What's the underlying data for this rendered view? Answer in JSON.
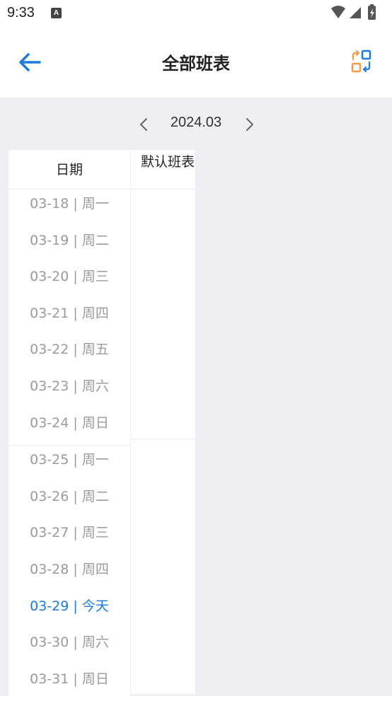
{
  "status": {
    "time": "9:33",
    "app_icon": "A"
  },
  "header": {
    "title": "全部班表",
    "back_icon": "arrow-left-icon",
    "switch_icon": "switch-schedule-icon",
    "accent_color": "#1a7be0"
  },
  "month_nav": {
    "label": "2024.03"
  },
  "table": {
    "date_header": "日期",
    "shift_header": "默认班表",
    "weeks": [
      {
        "days": [
          {
            "label": "03-18 | 周一",
            "today": false
          },
          {
            "label": "03-19 | 周二",
            "today": false
          },
          {
            "label": "03-20 | 周三",
            "today": false
          },
          {
            "label": "03-21 | 周四",
            "today": false
          },
          {
            "label": "03-22 | 周五",
            "today": false
          },
          {
            "label": "03-23 | 周六",
            "today": false
          },
          {
            "label": "03-24 | 周日",
            "today": false
          }
        ]
      },
      {
        "days": [
          {
            "label": "03-25 | 周一",
            "today": false
          },
          {
            "label": "03-26 | 周二",
            "today": false
          },
          {
            "label": "03-27 | 周三",
            "today": false
          },
          {
            "label": "03-28 | 周四",
            "today": false
          },
          {
            "label": "03-29 | 今天",
            "today": true
          },
          {
            "label": "03-30 | 周六",
            "today": false
          },
          {
            "label": "03-31 | 周日",
            "today": false
          }
        ]
      }
    ]
  }
}
